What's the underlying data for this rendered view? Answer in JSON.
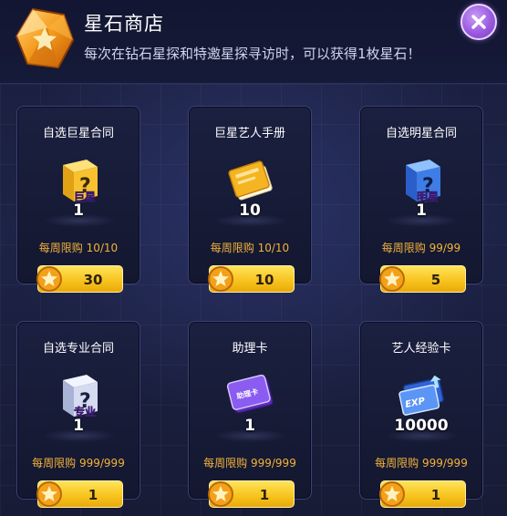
{
  "header": {
    "title": "星石商店",
    "subtitle": "每次在钻石星探和特邀星探寻访时，可以获得1枚星石！"
  },
  "items": [
    {
      "name": "自选巨星合同",
      "count": "1",
      "limit": "每周限购 10/10",
      "price": "30",
      "tag": "巨星",
      "icon": "gold-mystery-box-icon"
    },
    {
      "name": "巨星艺人手册",
      "count": "10",
      "limit": "每周限购 10/10",
      "price": "10",
      "tag": "",
      "icon": "golden-manual-icon"
    },
    {
      "name": "自选明星合同",
      "count": "1",
      "limit": "每周限购 99/99",
      "price": "5",
      "tag": "明星",
      "icon": "blue-mystery-box-icon"
    },
    {
      "name": "自选专业合同",
      "count": "1",
      "limit": "每周限购 999/999",
      "price": "1",
      "tag": "专业",
      "icon": "silver-mystery-box-icon"
    },
    {
      "name": "助理卡",
      "count": "1",
      "limit": "每周限购 999/999",
      "price": "1",
      "tag": "助理卡",
      "icon": "purple-assistant-card-icon"
    },
    {
      "name": "艺人经验卡",
      "count": "10000",
      "limit": "每周限购 999/999",
      "price": "1",
      "tag": "EXP",
      "icon": "blue-exp-ticket-icon"
    }
  ]
}
